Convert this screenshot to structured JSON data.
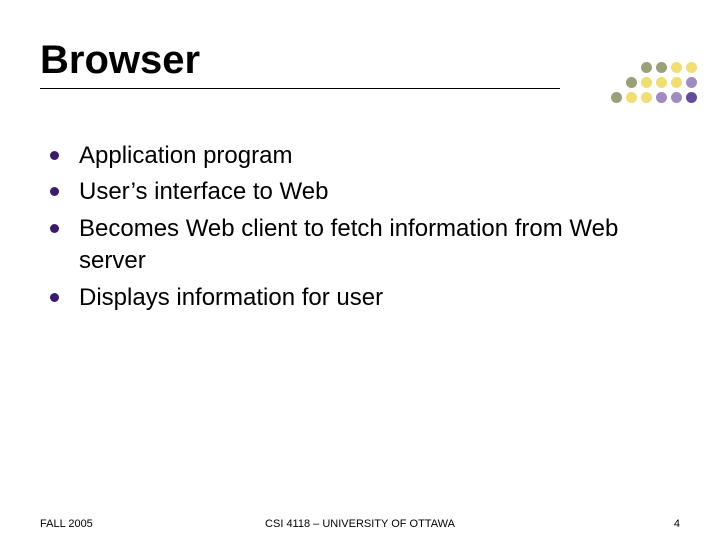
{
  "title": "Browser",
  "bullets": [
    "Application program",
    "User’s interface to Web",
    "Becomes Web client to fetch information from Web server",
    "Displays information for user"
  ],
  "footer": {
    "left": "FALL 2005",
    "center": "CSI 4118 – UNIVERSITY OF OTTAWA",
    "right": "4"
  }
}
